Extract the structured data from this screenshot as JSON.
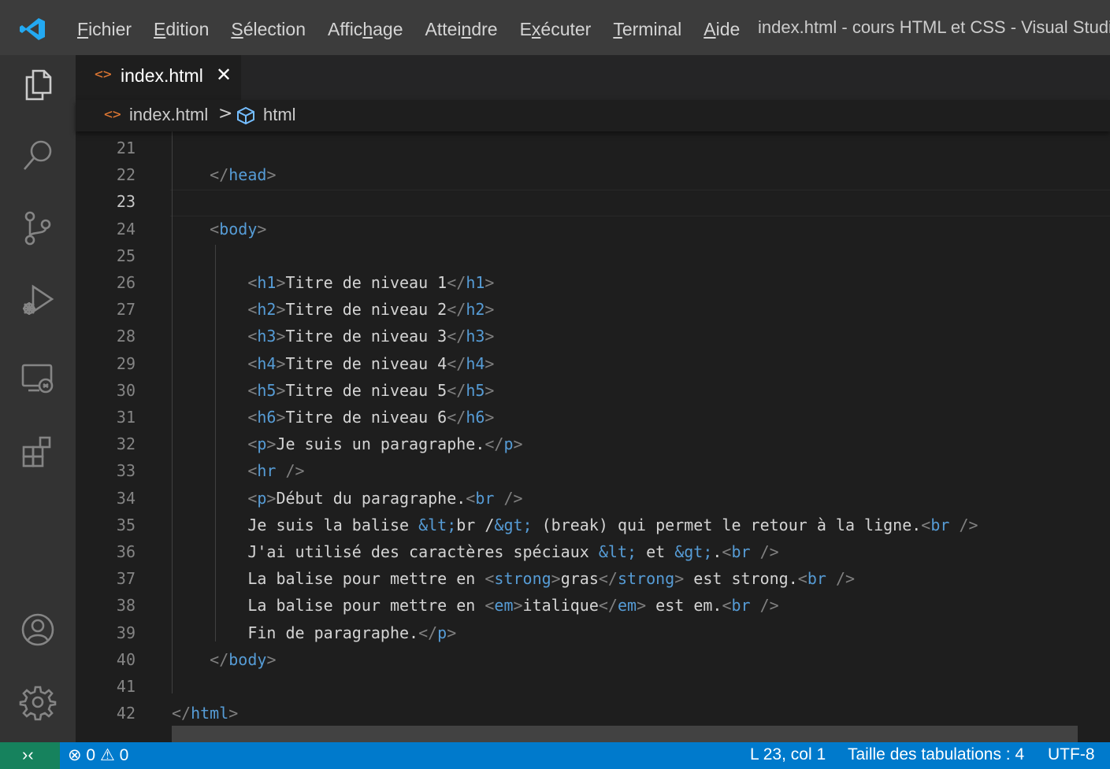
{
  "menu": [
    {
      "pre": "",
      "u": "F",
      "post": "ichier"
    },
    {
      "pre": "",
      "u": "E",
      "post": "dition"
    },
    {
      "pre": "",
      "u": "S",
      "post": "élection"
    },
    {
      "pre": "Affic",
      "u": "h",
      "post": "age"
    },
    {
      "pre": "Attei",
      "u": "n",
      "post": "dre"
    },
    {
      "pre": "E",
      "u": "x",
      "post": "écuter"
    },
    {
      "pre": "",
      "u": "T",
      "post": "erminal"
    },
    {
      "pre": "",
      "u": "A",
      "post": "ide"
    }
  ],
  "window_title": "index.html - cours HTML et CSS - Visual Studio",
  "tab": {
    "icon": "<>",
    "label": "index.html",
    "close": "✕"
  },
  "breadcrumb": {
    "file": "index.html",
    "separator": ">",
    "symbol": "html"
  },
  "editor": {
    "active_line": "23",
    "lines": [
      {
        "n": "21",
        "t": ""
      },
      {
        "n": "22",
        "t": "    </head>"
      },
      {
        "n": "23",
        "t": ""
      },
      {
        "n": "24",
        "t": "    <body>"
      },
      {
        "n": "25",
        "t": ""
      },
      {
        "n": "26",
        "t": "        <h1>Titre de niveau 1</h1>"
      },
      {
        "n": "27",
        "t": "        <h2>Titre de niveau 2</h2>"
      },
      {
        "n": "28",
        "t": "        <h3>Titre de niveau 3</h3>"
      },
      {
        "n": "29",
        "t": "        <h4>Titre de niveau 4</h4>"
      },
      {
        "n": "30",
        "t": "        <h5>Titre de niveau 5</h5>"
      },
      {
        "n": "31",
        "t": "        <h6>Titre de niveau 6</h6>"
      },
      {
        "n": "32",
        "t": "        <p>Je suis un paragraphe.</p>"
      },
      {
        "n": "33",
        "t": "        <hr />"
      },
      {
        "n": "34",
        "t": "        <p>Début du paragraphe.<br />"
      },
      {
        "n": "35",
        "t": "        Je suis la balise &lt;br /&gt; (break) qui permet le retour à la ligne.<br />"
      },
      {
        "n": "36",
        "t": "        J'ai utilisé des caractères spéciaux &lt; et &gt;.<br />"
      },
      {
        "n": "37",
        "t": "        La balise pour mettre en <strong>gras</strong> est strong.<br />"
      },
      {
        "n": "38",
        "t": "        La balise pour mettre en <em>italique</em> est em.<br />"
      },
      {
        "n": "39",
        "t": "        Fin de paragraphe.</p>"
      },
      {
        "n": "40",
        "t": "    </body>"
      },
      {
        "n": "41",
        "t": ""
      },
      {
        "n": "42",
        "t": "</html>"
      }
    ]
  },
  "status": {
    "remote_icon": "›‹",
    "problems": "⊗ 0 ⚠ 0",
    "cursor": "L 23, col 1",
    "tab_size": "Taille des tabulations : 4",
    "encoding": "UTF-8"
  },
  "colors": {
    "accent": "#007acc",
    "remote": "#16825d",
    "tag": "#569cd6",
    "bracket": "#808080",
    "file_icon": "#e37933"
  },
  "icons": [
    "vscode-logo-icon",
    "explorer-icon",
    "search-icon",
    "source-control-icon",
    "run-debug-icon",
    "remote-explorer-icon",
    "extensions-icon",
    "account-icon",
    "settings-gear-icon"
  ]
}
